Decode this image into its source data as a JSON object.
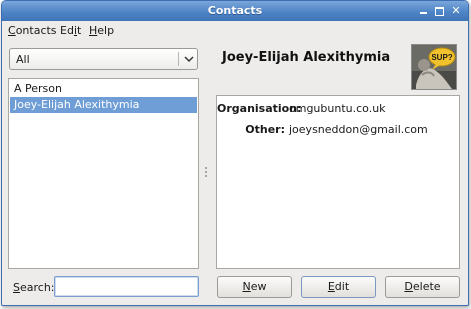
{
  "window": {
    "title": "Contacts"
  },
  "menubar": {
    "items": [
      {
        "label": "Contacts",
        "mnemonic": "C",
        "rest": "ontacts"
      },
      {
        "label": "Edit",
        "pre": "Ed",
        "mnemonic": "i",
        "rest": "t"
      },
      {
        "label": "Help",
        "mnemonic": "H",
        "rest": "elp"
      }
    ]
  },
  "sidebar": {
    "group_filter": {
      "value": "All"
    },
    "contacts": [
      {
        "name": "A Person",
        "selected": false
      },
      {
        "name": "Joey-Elijah Alexithymia",
        "selected": true
      }
    ],
    "search": {
      "label_mnemonic": "S",
      "label_rest": "earch:",
      "value": ""
    }
  },
  "contact": {
    "name": "Joey-Elijah Alexithymia",
    "avatar_text": "SUP?",
    "fields": [
      {
        "label": "Organisation:",
        "value": "omgubuntu.co.uk"
      },
      {
        "label": "Other:",
        "value": "joeysneddon@gmail.com"
      }
    ]
  },
  "actions": {
    "new": {
      "mnemonic": "N",
      "rest": "ew"
    },
    "edit": {
      "mnemonic": "E",
      "rest": "dit"
    },
    "delete": {
      "mnemonic": "D",
      "rest": "elete"
    }
  },
  "colors": {
    "selection": "#6f9ed6",
    "titlebar": "#4f84c6"
  },
  "icons": [
    "minimize-icon",
    "maximize-icon",
    "close-icon",
    "chevron-down-icon",
    "pane-grip-icon"
  ]
}
